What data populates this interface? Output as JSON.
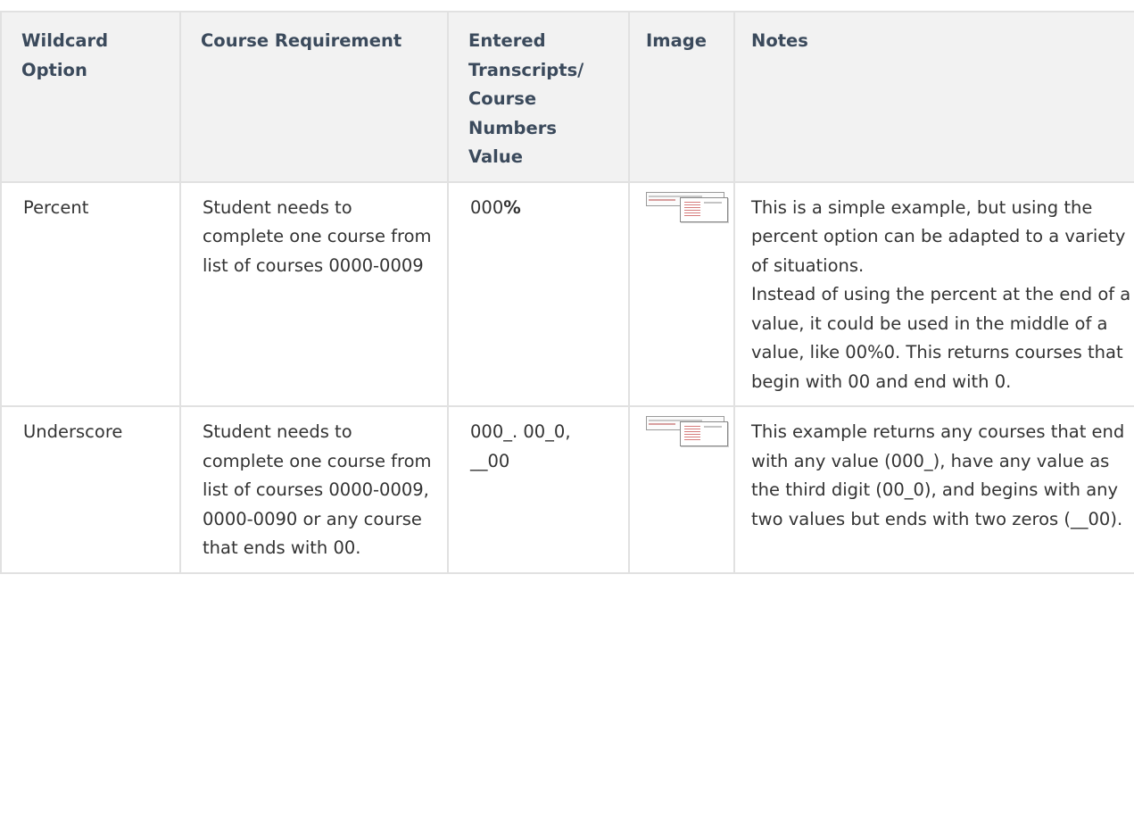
{
  "table": {
    "headers": {
      "wildcard_option": "Wildcard Option",
      "course_requirement": "Course Requirement",
      "entered_value": "Entered Transcripts/ Course Numbers Value",
      "image": "Image",
      "notes": "Notes"
    },
    "rows": [
      {
        "option": "Percent",
        "requirement": "Student needs to complete one course from list of courses 0000-0009",
        "value_prefix": "000",
        "value_suffix": "%",
        "image_icon": "screenshot-thumbnail",
        "notes_1": "This is a simple example, but using the percent option can be adapted to a variety of situations.",
        "notes_2": "Instead of using the percent at the end of a value, it could be used in the middle of a value, like 00%0. This returns courses that begin with 00 and end with 0."
      },
      {
        "option": "Underscore",
        "requirement": "Student needs to complete one course from list of courses 0000-0009, 0000-0090 or any course that ends with 00.",
        "value": "000_. 00_0, __00",
        "image_icon": "screenshot-thumbnail",
        "notes": "This example returns any courses that end with any value (000_), have any value as the third digit (00_0), and begins with any two values but ends with two zeros (__00)."
      }
    ]
  }
}
